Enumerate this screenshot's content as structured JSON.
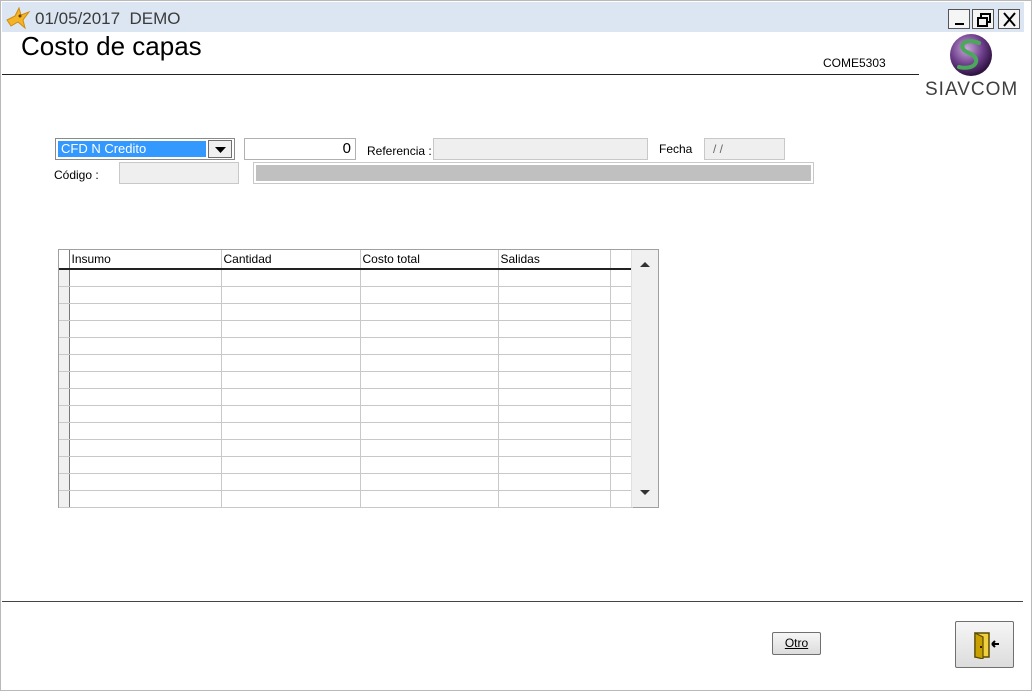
{
  "window": {
    "title": "01/05/2017  DEMO",
    "controls": {
      "minimize": "minimize-icon",
      "restore": "restore-icon",
      "close": "close-icon"
    }
  },
  "header": {
    "title": "Costo de capas",
    "form_code": "COME5303",
    "logo_text": "SIAVCOM"
  },
  "filters": {
    "doc_type": {
      "selected": "CFD N Credito"
    },
    "number": "0",
    "referencia_label": "Referencia :",
    "referencia_value": "",
    "fecha_label": "Fecha",
    "fecha_value": "/ /",
    "codigo_label": "Código :",
    "codigo_value": "",
    "descripcion_value": ""
  },
  "grid": {
    "columns": [
      "Insumo",
      "Cantidad",
      "Costo total",
      "Salidas"
    ],
    "rows": [
      [
        "",
        "",
        "",
        ""
      ],
      [
        "",
        "",
        "",
        ""
      ],
      [
        "",
        "",
        "",
        ""
      ],
      [
        "",
        "",
        "",
        ""
      ],
      [
        "",
        "",
        "",
        ""
      ],
      [
        "",
        "",
        "",
        ""
      ],
      [
        "",
        "",
        "",
        ""
      ],
      [
        "",
        "",
        "",
        ""
      ],
      [
        "",
        "",
        "",
        ""
      ],
      [
        "",
        "",
        "",
        ""
      ],
      [
        "",
        "",
        "",
        ""
      ],
      [
        "",
        "",
        "",
        ""
      ],
      [
        "",
        "",
        "",
        ""
      ],
      [
        "",
        "",
        "",
        ""
      ]
    ]
  },
  "footer": {
    "otro_label": "Otro",
    "exit_icon": "exit-door-icon"
  },
  "colors": {
    "titlebar": "#dce6f2",
    "selection": "#3399ff",
    "readonly": "#efefef",
    "exit_icon": "#c8a000"
  }
}
